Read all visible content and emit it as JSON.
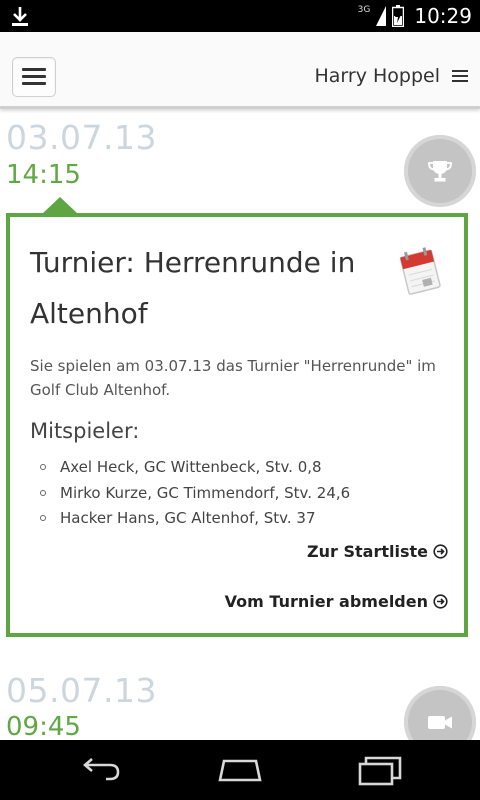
{
  "status_bar": {
    "network": "3G",
    "time": "10:29",
    "icons": [
      "download-icon",
      "signal-icon",
      "battery-icon"
    ]
  },
  "header": {
    "user_name": "Harry Hoppel",
    "menu_icon": "hamburger-menu-icon",
    "user_menu_icon": "list-menu-icon"
  },
  "entries": [
    {
      "date": "03.07.13",
      "time": "14:15",
      "icon": "trophy-icon"
    },
    {
      "date": "05.07.13",
      "time": "09:45",
      "icon": "video-camera-icon"
    }
  ],
  "card": {
    "title": "Turnier: Herrenrunde in Altenhof",
    "description": "Sie spielen am 03.07.13 das Turnier \"Herrenrunde\" im Golf Club Altenhof.",
    "players_heading": "Mitspieler:",
    "players": [
      "Axel Heck, GC Wittenbeck, Stv. 0,8",
      "Mirko Kurze, GC Timmendorf, Stv. 24,6",
      "Hacker Hans, GC Altenhof, Stv. 37"
    ],
    "startlist_link": "Zur Startliste",
    "unsubscribe_link": "Vom Turnier abmelden",
    "icon": "calendar-icon"
  },
  "navigation": {
    "buttons": [
      "back-icon",
      "home-icon",
      "recent-apps-icon"
    ]
  },
  "colors": {
    "accent_green": "#5da641",
    "time_green": "#61a843",
    "date_gray": "#cdd6dd"
  }
}
